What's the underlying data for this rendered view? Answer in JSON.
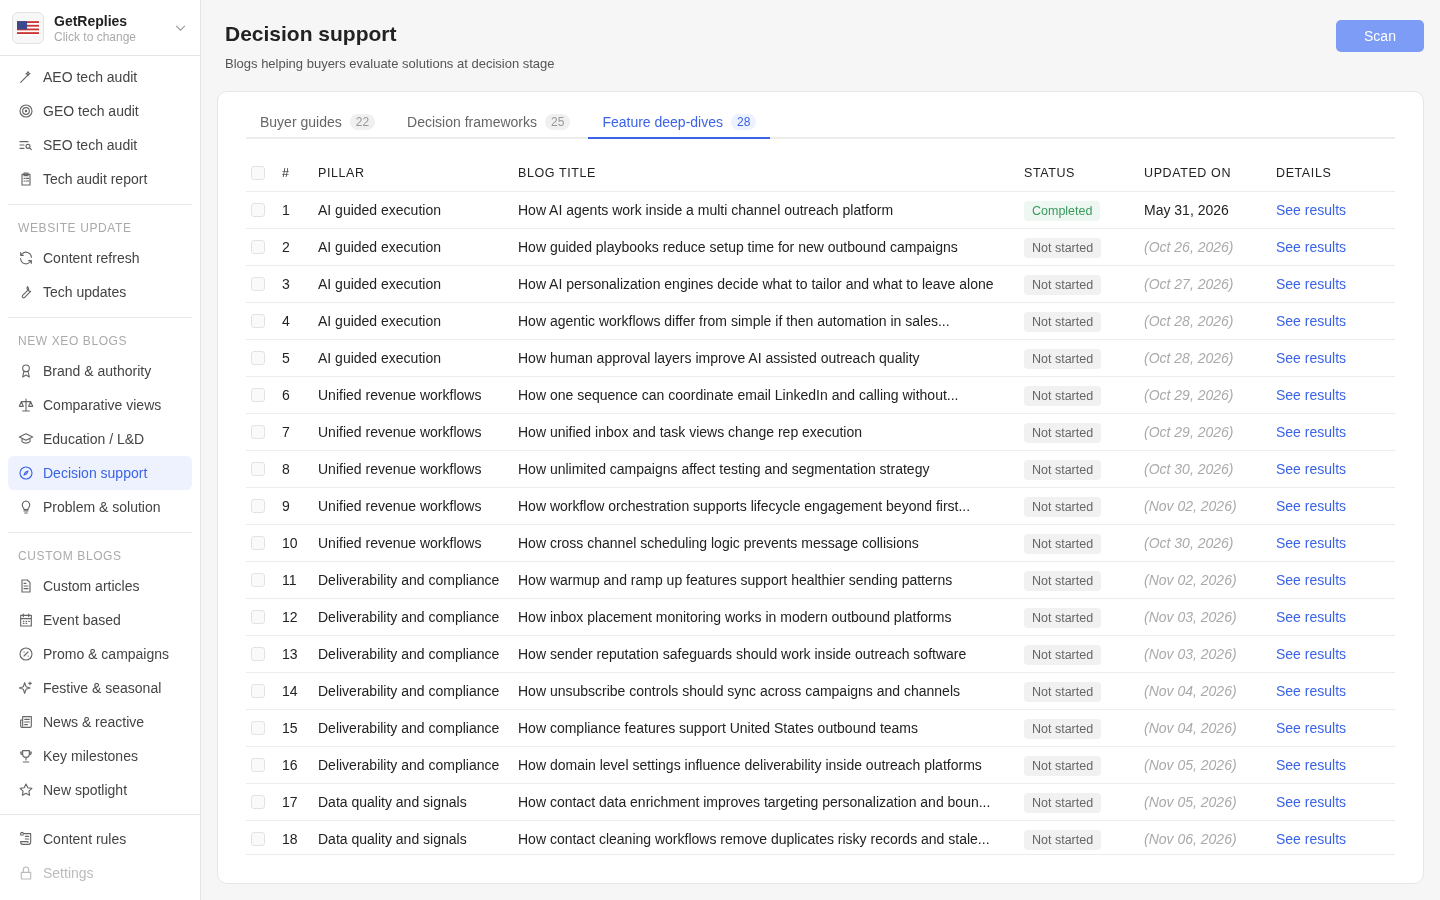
{
  "workspace": {
    "name": "GetReplies",
    "hint": "Click to change"
  },
  "sidebar": {
    "sections": [
      {
        "items": [
          {
            "label": "AEO tech audit",
            "selected": false
          },
          {
            "label": "GEO tech audit",
            "selected": false
          },
          {
            "label": "SEO tech audit",
            "selected": false
          },
          {
            "label": "Tech audit report",
            "selected": false
          }
        ]
      },
      {
        "heading": "WEBSITE UPDATE",
        "items": [
          {
            "label": "Content refresh",
            "selected": false
          },
          {
            "label": "Tech updates",
            "selected": false
          }
        ]
      },
      {
        "heading": "NEW XEO BLOGS",
        "items": [
          {
            "label": "Brand & authority",
            "selected": false
          },
          {
            "label": "Comparative views",
            "selected": false
          },
          {
            "label": "Education / L&D",
            "selected": false
          },
          {
            "label": "Decision support",
            "selected": true
          },
          {
            "label": "Problem & solution",
            "selected": false
          }
        ]
      },
      {
        "heading": "CUSTOM BLOGS",
        "items": [
          {
            "label": "Custom articles",
            "selected": false
          },
          {
            "label": "Event based",
            "selected": false
          },
          {
            "label": "Promo & campaigns",
            "selected": false
          },
          {
            "label": "Festive & seasonal",
            "selected": false
          },
          {
            "label": "News & reactive",
            "selected": false
          },
          {
            "label": "Key milestones",
            "selected": false
          },
          {
            "label": "New spotlight",
            "selected": false
          }
        ]
      }
    ],
    "footer": [
      {
        "label": "Content rules",
        "disabled": false
      },
      {
        "label": "Settings",
        "disabled": true
      }
    ]
  },
  "page": {
    "title": "Decision support",
    "subtitle": "Blogs helping buyers evaluate solutions at decision stage",
    "action": "Scan"
  },
  "tabs": [
    {
      "label": "Buyer guides",
      "count": "22",
      "selected": false
    },
    {
      "label": "Decision frameworks",
      "count": "25",
      "selected": false
    },
    {
      "label": "Feature deep-dives",
      "count": "28",
      "selected": true
    }
  ],
  "table": {
    "columns": [
      "#",
      "PILLAR",
      "BLOG TITLE",
      "STATUS",
      "UPDATED ON",
      "DETAILS"
    ],
    "header_checked": false,
    "rows": [
      {
        "num": "1",
        "pillar": "AI guided execution",
        "title": "How AI agents work inside a multi channel outreach platform",
        "status": "Completed",
        "kind": "completed",
        "updated": "May 31, 2026",
        "planned": false,
        "details": "See results",
        "checked": false
      },
      {
        "num": "2",
        "pillar": "AI guided execution",
        "title": "How guided playbooks reduce setup time for new outbound campaigns",
        "status": "Not started",
        "kind": "pending",
        "updated": "(Oct 26, 2026)",
        "planned": true,
        "details": "See results",
        "checked": false
      },
      {
        "num": "3",
        "pillar": "AI guided execution",
        "title": "How AI personalization engines decide what to tailor and what to leave alone",
        "status": "Not started",
        "kind": "pending",
        "updated": "(Oct 27, 2026)",
        "planned": true,
        "details": "See results",
        "checked": false
      },
      {
        "num": "4",
        "pillar": "AI guided execution",
        "title": "How agentic workflows differ from simple if then automation in sales...",
        "status": "Not started",
        "kind": "pending",
        "updated": "(Oct 28, 2026)",
        "planned": true,
        "details": "See results",
        "checked": false
      },
      {
        "num": "5",
        "pillar": "AI guided execution",
        "title": "How human approval layers improve AI assisted outreach quality",
        "status": "Not started",
        "kind": "pending",
        "updated": "(Oct 28, 2026)",
        "planned": true,
        "details": "See results",
        "checked": false
      },
      {
        "num": "6",
        "pillar": "Unified revenue workflows",
        "title": "How one sequence can coordinate email LinkedIn and calling without...",
        "status": "Not started",
        "kind": "pending",
        "updated": "(Oct 29, 2026)",
        "planned": true,
        "details": "See results",
        "checked": false
      },
      {
        "num": "7",
        "pillar": "Unified revenue workflows",
        "title": "How unified inbox and task views change rep execution",
        "status": "Not started",
        "kind": "pending",
        "updated": "(Oct 29, 2026)",
        "planned": true,
        "details": "See results",
        "checked": false
      },
      {
        "num": "8",
        "pillar": "Unified revenue workflows",
        "title": "How unlimited campaigns affect testing and segmentation strategy",
        "status": "Not started",
        "kind": "pending",
        "updated": "(Oct 30, 2026)",
        "planned": true,
        "details": "See results",
        "checked": false
      },
      {
        "num": "9",
        "pillar": "Unified revenue workflows",
        "title": "How workflow orchestration supports lifecycle engagement beyond first...",
        "status": "Not started",
        "kind": "pending",
        "updated": "(Nov 02, 2026)",
        "planned": true,
        "details": "See results",
        "checked": false
      },
      {
        "num": "10",
        "pillar": "Unified revenue workflows",
        "title": "How cross channel scheduling logic prevents message collisions",
        "status": "Not started",
        "kind": "pending",
        "updated": "(Oct 30, 2026)",
        "planned": true,
        "details": "See results",
        "checked": false
      },
      {
        "num": "11",
        "pillar": "Deliverability and compliance",
        "title": "How warmup and ramp up features support healthier sending patterns",
        "status": "Not started",
        "kind": "pending",
        "updated": "(Nov 02, 2026)",
        "planned": true,
        "details": "See results",
        "checked": false
      },
      {
        "num": "12",
        "pillar": "Deliverability and compliance",
        "title": "How inbox placement monitoring works in modern outbound platforms",
        "status": "Not started",
        "kind": "pending",
        "updated": "(Nov 03, 2026)",
        "planned": true,
        "details": "See results",
        "checked": false
      },
      {
        "num": "13",
        "pillar": "Deliverability and compliance",
        "title": "How sender reputation safeguards should work inside outreach software",
        "status": "Not started",
        "kind": "pending",
        "updated": "(Nov 03, 2026)",
        "planned": true,
        "details": "See results",
        "checked": false
      },
      {
        "num": "14",
        "pillar": "Deliverability and compliance",
        "title": "How unsubscribe controls should sync across campaigns and channels",
        "status": "Not started",
        "kind": "pending",
        "updated": "(Nov 04, 2026)",
        "planned": true,
        "details": "See results",
        "checked": false
      },
      {
        "num": "15",
        "pillar": "Deliverability and compliance",
        "title": "How compliance features support United States outbound teams",
        "status": "Not started",
        "kind": "pending",
        "updated": "(Nov 04, 2026)",
        "planned": true,
        "details": "See results",
        "checked": false
      },
      {
        "num": "16",
        "pillar": "Deliverability and compliance",
        "title": "How domain level settings influence deliverability inside outreach platforms",
        "status": "Not started",
        "kind": "pending",
        "updated": "(Nov 05, 2026)",
        "planned": true,
        "details": "See results",
        "checked": false
      },
      {
        "num": "17",
        "pillar": "Data quality and signals",
        "title": "How contact data enrichment improves targeting personalization and boun...",
        "status": "Not started",
        "kind": "pending",
        "updated": "(Nov 05, 2026)",
        "planned": true,
        "details": "See results",
        "checked": false
      },
      {
        "num": "18",
        "pillar": "Data quality and signals",
        "title": "How contact cleaning workflows remove duplicates risky records and stale...",
        "status": "Not started",
        "kind": "pending",
        "updated": "(Nov 06, 2026)",
        "planned": true,
        "details": "See results",
        "checked": false
      }
    ]
  }
}
